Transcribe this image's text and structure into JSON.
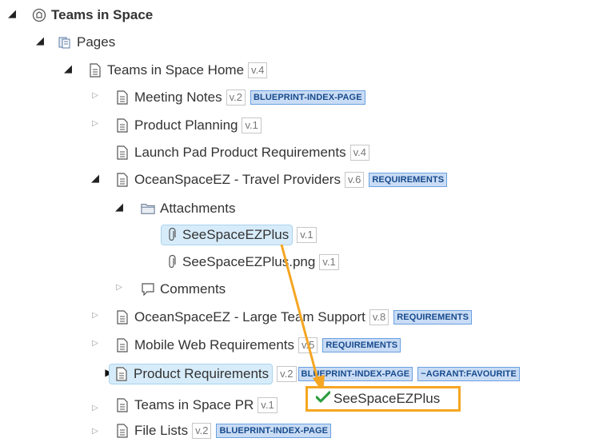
{
  "tree": {
    "root": {
      "label": "Teams in Space"
    },
    "pages": {
      "label": "Pages"
    },
    "home": {
      "label": "Teams in Space Home",
      "version": "v.4"
    },
    "meeting_notes": {
      "label": "Meeting Notes",
      "version": "v.2",
      "badge": "BLUEPRINT-INDEX-PAGE"
    },
    "product_planning": {
      "label": "Product Planning",
      "version": "v.1"
    },
    "launch_pad": {
      "label": "Launch Pad Product Requirements",
      "version": "v.4"
    },
    "travel_providers": {
      "label": "OceanSpaceEZ - Travel Providers",
      "version": "v.6",
      "badge": "REQUIREMENTS"
    },
    "attachments": {
      "label": "Attachments"
    },
    "attachment1": {
      "label": "SeeSpaceEZPlus",
      "version": "v.1"
    },
    "attachment2": {
      "label": "SeeSpaceEZPlus.png",
      "version": "v.1"
    },
    "comments": {
      "label": "Comments"
    },
    "large_team": {
      "label": "OceanSpaceEZ - Large Team Support",
      "version": "v.8",
      "badge": "REQUIREMENTS"
    },
    "mobile_web": {
      "label": "Mobile Web Requirements",
      "version": "v.5",
      "badge": "REQUIREMENTS"
    },
    "product_requirements": {
      "label": "Product Requirements",
      "version": "v.2",
      "badge1": "BLUEPRINT-INDEX-PAGE",
      "badge2": "~AGRANT:FAVOURITE"
    },
    "teams_pr": {
      "label": "Teams in Space PR",
      "version": "v.1"
    },
    "file_lists": {
      "label": "File Lists",
      "version": "v.2",
      "badge": "BLUEPRINT-INDEX-PAGE"
    }
  },
  "drag_tooltip": {
    "label": "SeeSpaceEZPlus",
    "icon": "check-icon"
  },
  "colors": {
    "accent": "#f5a623",
    "badge_bg": "#c9dcf5",
    "badge_text": "#174a8c",
    "check": "#2e9e3f",
    "selected_bg": "#d7ecfa"
  }
}
